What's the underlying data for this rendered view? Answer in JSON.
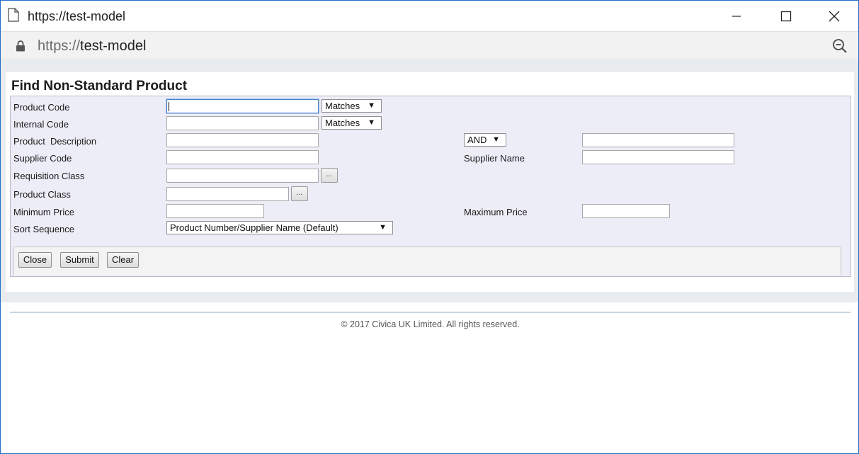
{
  "window": {
    "title": "https://test-model",
    "minimize_label": "Minimize",
    "maximize_label": "Maximize",
    "close_label": "Close"
  },
  "address": {
    "protocol": "https://",
    "host": "test-model"
  },
  "page": {
    "title": "Find Non-Standard Product",
    "fields": {
      "product_code": {
        "label": "Product Code",
        "value": "",
        "match": "Matches"
      },
      "internal_code": {
        "label": "Internal Code",
        "value": "",
        "match": "Matches"
      },
      "product_description": {
        "label": "Product  Description",
        "value": "",
        "operator": "AND",
        "value2": ""
      },
      "supplier_code": {
        "label": "Supplier Code",
        "value": ""
      },
      "supplier_name": {
        "label": "Supplier Name",
        "value": ""
      },
      "requisition_class": {
        "label": "Requisition Class",
        "value": "",
        "lookup": "..."
      },
      "product_class": {
        "label": "Product Class",
        "value": "",
        "lookup": "..."
      },
      "minimum_price": {
        "label": "Minimum Price",
        "value": ""
      },
      "maximum_price": {
        "label": "Maximum Price",
        "value": ""
      },
      "sort_sequence": {
        "label": "Sort Sequence",
        "value": "Product Number/Supplier Name (Default)"
      }
    },
    "buttons": {
      "close": "Close",
      "submit": "Submit",
      "clear": "Clear"
    },
    "footer": "© 2017 Civica UK Limited. All rights reserved."
  }
}
